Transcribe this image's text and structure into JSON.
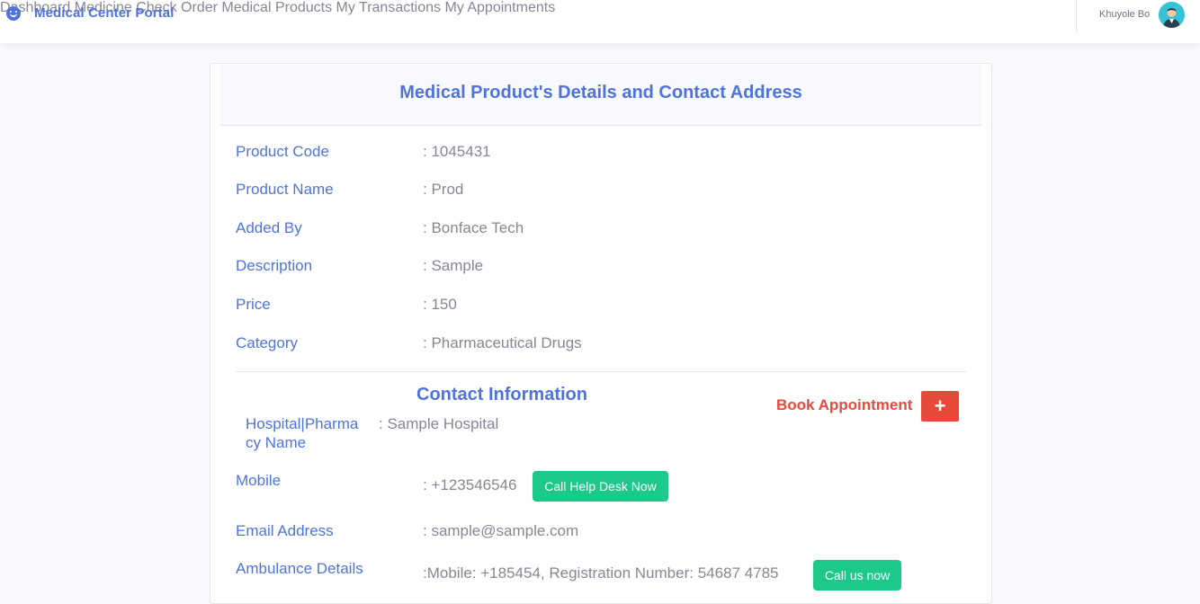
{
  "brand": {
    "title": "Medical Center Portal",
    "icon": "smiley-icon"
  },
  "nav": [
    {
      "label": "Dashboard"
    },
    {
      "label": "Medicine Check"
    },
    {
      "label": "Order Medical Products"
    },
    {
      "label": "My Transactions"
    },
    {
      "label": "My Appointments"
    }
  ],
  "user": {
    "name": "Khuyole Bo",
    "avatar": "user-avatar"
  },
  "card": {
    "title": "Medical Product's Details and Contact Address"
  },
  "product": {
    "code_label": "Product Code",
    "code_value": ": 1045431",
    "name_label": "Product Name",
    "name_value": ": Prod",
    "added_label": "Added By",
    "added_value": ": Bonface Tech",
    "desc_label": "Description",
    "desc_value": ": Sample",
    "price_label": "Price",
    "price_value": ": 150",
    "category_label": "Category",
    "category_value": ": Pharmaceutical Drugs"
  },
  "contact": {
    "title": "Contact Information",
    "book_label": "Book Appointment",
    "book_button": "+",
    "hospital_label": "Hospital|Pharmacy Name",
    "hospital_value": ": Sample Hospital",
    "mobile_label": "Mobile",
    "mobile_value": ": +123546546",
    "mobile_button": "Call Help Desk Now",
    "email_label": "Email Address",
    "email_value": ": sample@sample.com",
    "ambulance_label": "Ambulance Details",
    "ambulance_value": ":Mobile: +185454, Registration Number: 54687 4785",
    "ambulance_button": "Call us now"
  },
  "colors": {
    "primary": "#4e73df",
    "danger": "#e74a3b",
    "success": "#1cc88a",
    "text": "#858796"
  }
}
